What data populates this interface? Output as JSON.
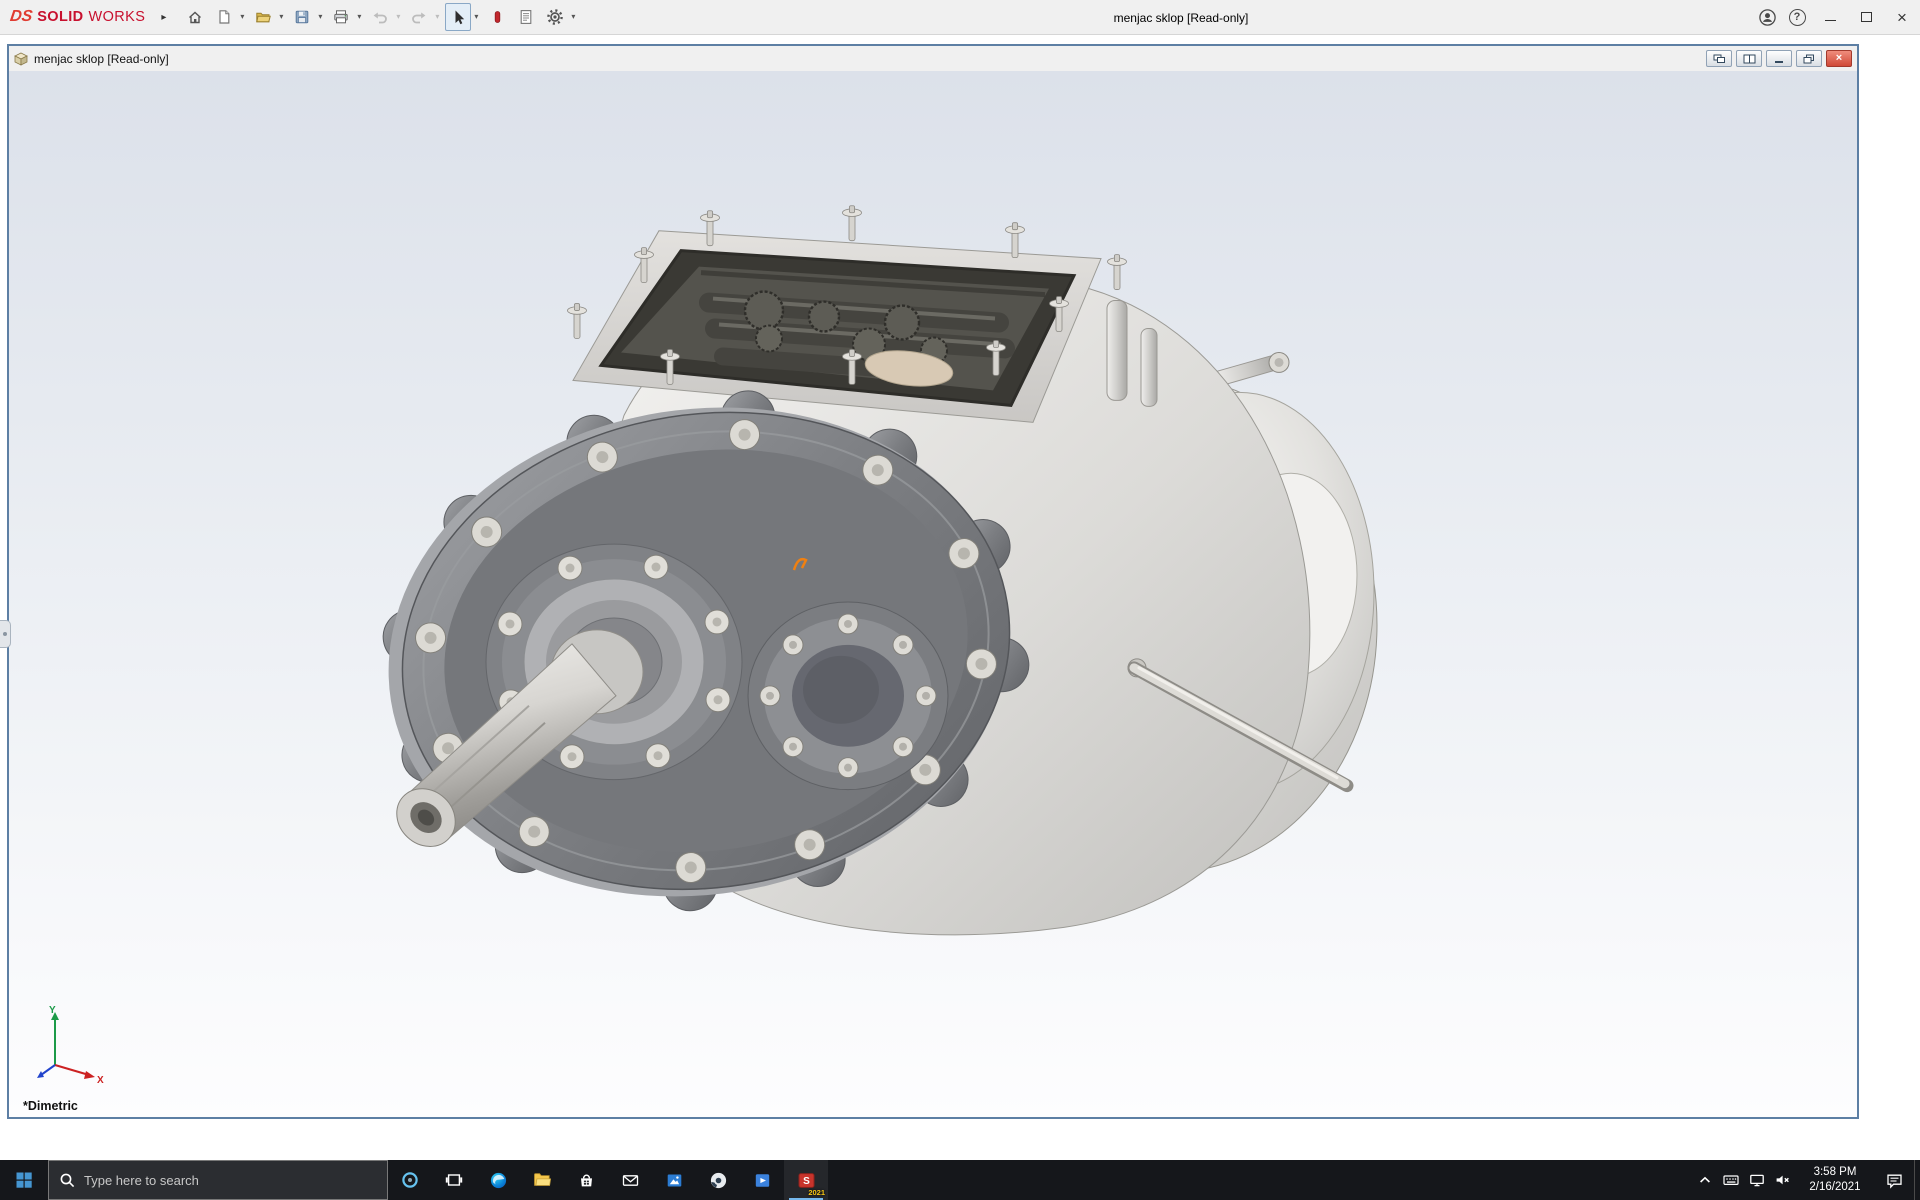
{
  "app": {
    "brand": {
      "mark": "DS",
      "solid": "SOLID",
      "works": "WORKS"
    },
    "title": "menjac sklop [Read-only]"
  },
  "document": {
    "title": "menjac sklop [Read-only]",
    "view_orientation": "*Dimetric"
  },
  "viewport": {
    "triad": {
      "x": "X",
      "y": "Y"
    },
    "background_top": "#dce1ea",
    "background_bottom": "#fdfdfe",
    "model": "gray cast-metal gearbox housing with bolted front flange, splined input shaft, top inspection opening with gasket and gear shafts, bell-shaped rear housing, selector rod"
  },
  "toolbar": {
    "items": [
      "home",
      "new-document",
      "open",
      "save",
      "print",
      "undo",
      "redo",
      "select",
      "3dexperience",
      "file-properties",
      "options"
    ]
  },
  "taskbar": {
    "search_placeholder": "Type here to search",
    "apps": [
      "edge",
      "file-explorer",
      "microsoft-store",
      "mail",
      "photos",
      "media-player",
      "movies-tv",
      "solidworks-2021"
    ],
    "solidworks_badge": "2021",
    "clock": {
      "time": "3:58 PM",
      "date": "2/16/2021"
    }
  },
  "glyphs": {
    "dropdown_caret": "▾",
    "flyout_arrow": "▸",
    "help": "?",
    "close": "×"
  },
  "colors": {
    "accent_blue": "#0078d7",
    "logo_red": "#c8102e",
    "doc_frame_blue": "#5d7fa4",
    "taskbar_bg": "#15171b",
    "close_red": "#d04937"
  }
}
